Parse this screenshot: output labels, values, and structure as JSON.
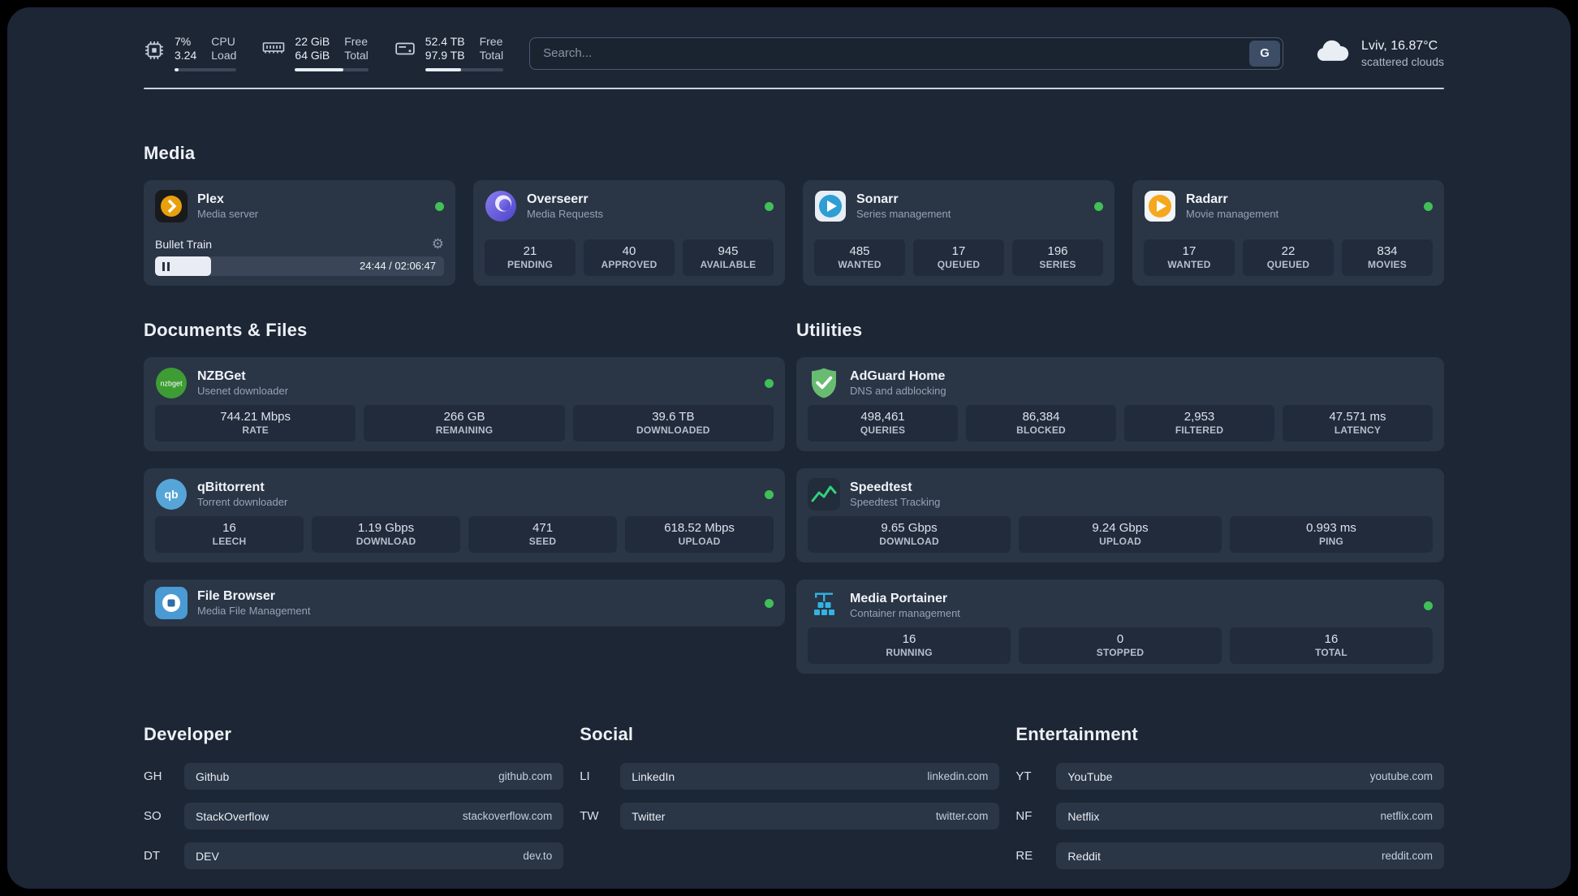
{
  "header": {
    "cpu": {
      "value_top": "7%",
      "value_bottom": "3.24",
      "label_top": "CPU",
      "label_bottom": "Load",
      "bar_percent": 7
    },
    "ram": {
      "value_top": "22 GiB",
      "value_bottom": "64 GiB",
      "label_top": "Free",
      "label_bottom": "Total",
      "bar_percent": 66
    },
    "disk": {
      "value_top": "52.4 TB",
      "value_bottom": "97.9 TB",
      "label_top": "Free",
      "label_bottom": "Total",
      "bar_percent": 46
    },
    "search": {
      "placeholder": "Search...",
      "button_label": "G"
    },
    "weather": {
      "location": "Lviv, 16.87°C",
      "condition": "scattered clouds"
    }
  },
  "section_titles": {
    "media": "Media",
    "documents": "Documents & Files",
    "utilities": "Utilities",
    "developer": "Developer",
    "social": "Social",
    "entertainment": "Entertainment"
  },
  "apps": {
    "plex": {
      "name": "Plex",
      "subtitle": "Media server",
      "player": {
        "track": "Bullet Train",
        "time": "24:44 / 02:06:47",
        "progress_percent": 19.5
      }
    },
    "overseerr": {
      "name": "Overseerr",
      "subtitle": "Media Requests",
      "stats": [
        {
          "value": "21",
          "label": "PENDING"
        },
        {
          "value": "40",
          "label": "APPROVED"
        },
        {
          "value": "945",
          "label": "AVAILABLE"
        }
      ]
    },
    "sonarr": {
      "name": "Sonarr",
      "subtitle": "Series management",
      "stats": [
        {
          "value": "485",
          "label": "WANTED"
        },
        {
          "value": "17",
          "label": "QUEUED"
        },
        {
          "value": "196",
          "label": "SERIES"
        }
      ]
    },
    "radarr": {
      "name": "Radarr",
      "subtitle": "Movie management",
      "stats": [
        {
          "value": "17",
          "label": "WANTED"
        },
        {
          "value": "22",
          "label": "QUEUED"
        },
        {
          "value": "834",
          "label": "MOVIES"
        }
      ]
    },
    "nzbget": {
      "name": "NZBGet",
      "subtitle": "Usenet downloader",
      "stats": [
        {
          "value": "744.21 Mbps",
          "label": "RATE"
        },
        {
          "value": "266 GB",
          "label": "REMAINING"
        },
        {
          "value": "39.6 TB",
          "label": "DOWNLOADED"
        }
      ]
    },
    "qbittorrent": {
      "name": "qBittorrent",
      "subtitle": "Torrent downloader",
      "stats": [
        {
          "value": "16",
          "label": "LEECH"
        },
        {
          "value": "1.19 Gbps",
          "label": "DOWNLOAD"
        },
        {
          "value": "471",
          "label": "SEED"
        },
        {
          "value": "618.52 Mbps",
          "label": "UPLOAD"
        }
      ]
    },
    "filebrowser": {
      "name": "File Browser",
      "subtitle": "Media File Management"
    },
    "adguard": {
      "name": "AdGuard Home",
      "subtitle": "DNS and adblocking",
      "stats": [
        {
          "value": "498,461",
          "label": "QUERIES"
        },
        {
          "value": "86,384",
          "label": "BLOCKED"
        },
        {
          "value": "2,953",
          "label": "FILTERED"
        },
        {
          "value": "47.571 ms",
          "label": "LATENCY"
        }
      ]
    },
    "speedtest": {
      "name": "Speedtest",
      "subtitle": "Speedtest Tracking",
      "stats": [
        {
          "value": "9.65 Gbps",
          "label": "DOWNLOAD"
        },
        {
          "value": "9.24 Gbps",
          "label": "UPLOAD"
        },
        {
          "value": "0.993 ms",
          "label": "PING"
        }
      ]
    },
    "portainer": {
      "name": "Media Portainer",
      "subtitle": "Container management",
      "stats": [
        {
          "value": "16",
          "label": "RUNNING"
        },
        {
          "value": "0",
          "label": "STOPPED"
        },
        {
          "value": "16",
          "label": "TOTAL"
        }
      ]
    }
  },
  "links": {
    "developer": [
      {
        "abbr": "GH",
        "name": "Github",
        "url": "github.com"
      },
      {
        "abbr": "SO",
        "name": "StackOverflow",
        "url": "stackoverflow.com"
      },
      {
        "abbr": "DT",
        "name": "DEV",
        "url": "dev.to"
      }
    ],
    "social": [
      {
        "abbr": "LI",
        "name": "LinkedIn",
        "url": "linkedin.com"
      },
      {
        "abbr": "TW",
        "name": "Twitter",
        "url": "twitter.com"
      }
    ],
    "entertainment": [
      {
        "abbr": "YT",
        "name": "YouTube",
        "url": "youtube.com"
      },
      {
        "abbr": "NF",
        "name": "Netflix",
        "url": "netflix.com"
      },
      {
        "abbr": "RE",
        "name": "Reddit",
        "url": "reddit.com"
      }
    ]
  },
  "colors": {
    "status_online": "#40c057",
    "accent_green": "#2fd27d"
  }
}
